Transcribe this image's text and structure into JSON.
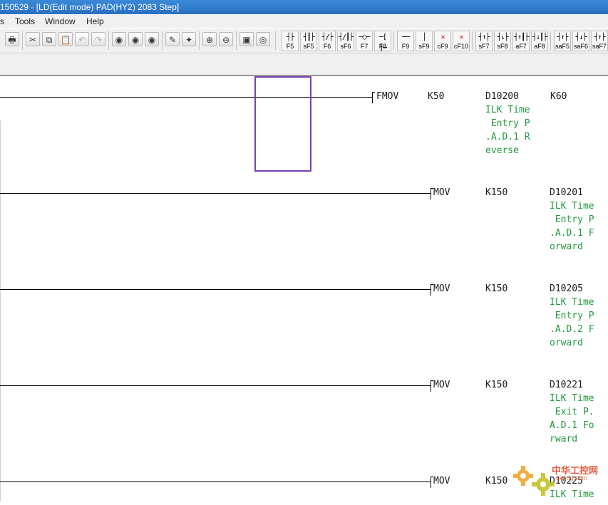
{
  "window": {
    "title": "150529 - [LD(Edit mode)     PAD(HY2)     2083 Step]"
  },
  "menu": {
    "items": [
      "s",
      "Tools",
      "Window",
      "Help"
    ]
  },
  "toolbar": {
    "fkeys": [
      {
        "symbol": "┤├",
        "label": "F5"
      },
      {
        "symbol": "┤┃├",
        "label": "sF5"
      },
      {
        "symbol": "┤/├",
        "label": "F6"
      },
      {
        "symbol": "┤/┃├",
        "label": "sF6"
      },
      {
        "symbol": "─○─",
        "label": "F7"
      },
      {
        "symbol": "─[ ]─",
        "label": "F8"
      },
      {
        "symbol": "──",
        "label": "F9"
      },
      {
        "symbol": "│",
        "label": "sF9"
      },
      {
        "symbol": "✕",
        "label": "cF9"
      },
      {
        "symbol": "✕",
        "label": "cF10"
      },
      {
        "symbol": "┤↑├",
        "label": "sF7"
      },
      {
        "symbol": "┤↓├",
        "label": "sF8"
      },
      {
        "symbol": "┤↑┃├",
        "label": "aF7"
      },
      {
        "symbol": "┤↓┃├",
        "label": "aF8"
      },
      {
        "symbol": "┤↑├",
        "label": "saF5"
      },
      {
        "symbol": "┤↓├",
        "label": "saF6"
      },
      {
        "symbol": "┤↑├",
        "label": "saF7"
      }
    ]
  },
  "rungs": [
    {
      "instruction": "FMOV",
      "operand1": "K50",
      "operand2": "D10200",
      "operand3": "K60",
      "comment_lines": [
        "ILK Time",
        " Entry P",
        ".A.D.1 R",
        "everse"
      ]
    },
    {
      "instruction": "MOV",
      "operand1": "K150",
      "operand2": "D10201",
      "comment_lines": [
        "ILK Time",
        " Entry P",
        ".A.D.1 F",
        "orward"
      ]
    },
    {
      "instruction": "MOV",
      "operand1": "K150",
      "operand2": "D10205",
      "comment_lines": [
        "ILK Time",
        " Entry P",
        ".A.D.2 F",
        "orward"
      ]
    },
    {
      "instruction": "MOV",
      "operand1": "K150",
      "operand2": "D10221",
      "comment_lines": [
        "ILK Time",
        " Exit P.",
        "A.D.1 Fo",
        "rward"
      ]
    },
    {
      "instruction": "MOV",
      "operand1": "K150",
      "operand2": "D10225",
      "comment_lines": [
        "ILK Time"
      ]
    }
  ],
  "watermark": {
    "text": "中华工控网",
    "subtext": "gkong.com"
  },
  "colors": {
    "comment": "#1f9a3a",
    "cursor": "#7a3fb0",
    "title_bar": "#2a6fc0"
  }
}
